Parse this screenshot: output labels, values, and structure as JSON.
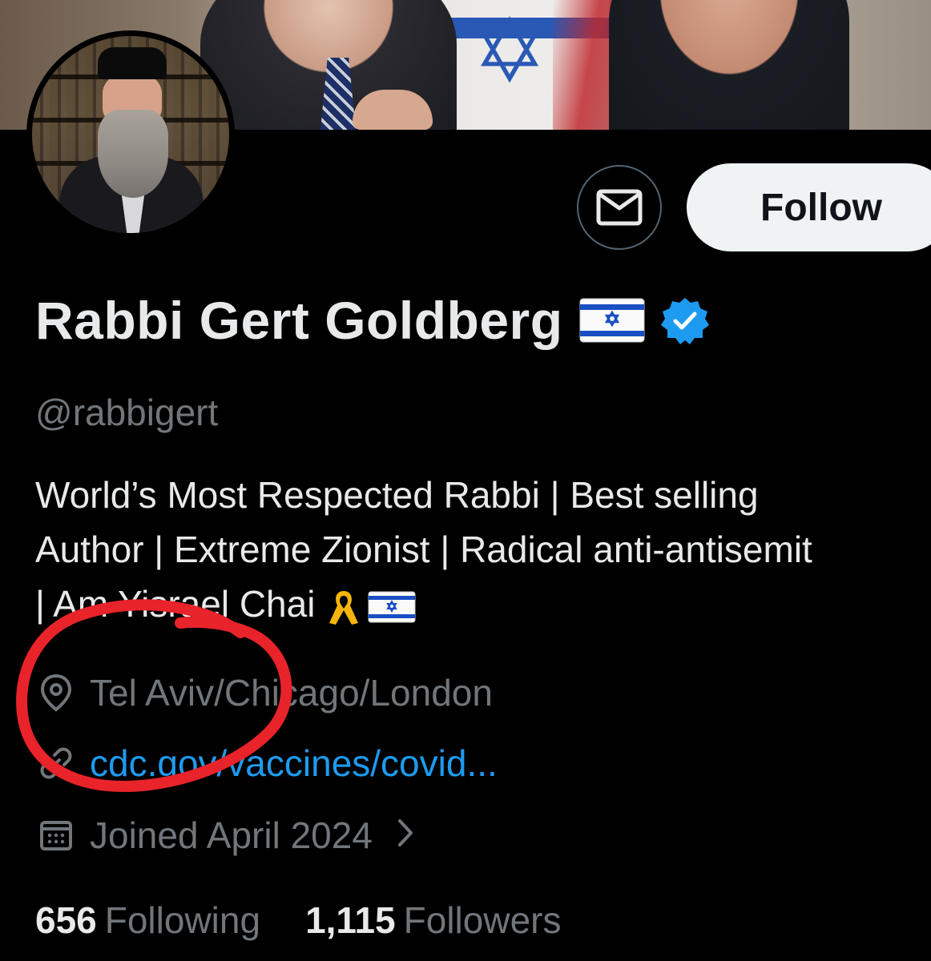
{
  "profile": {
    "display_name": "Rabbi Gert Goldberg",
    "handle": "@rabbigert",
    "bio_lines": [
      "World’s Most Respected Rabbi | Best selling",
      "Author | Extreme Zionist | Radical anti-antisemit",
      "| Am Yisrael Chai"
    ],
    "location": "Tel Aviv/Chicago/London",
    "website": "cdc.gov/vaccines/covid...",
    "joined": "Joined April 2024"
  },
  "actions": {
    "follow_label": "Follow"
  },
  "stats": {
    "following_count": "656",
    "following_label": "Following",
    "followers_count": "1,115",
    "followers_label": "Followers"
  },
  "icons": {
    "message": "envelope-icon",
    "verified": "verified-badge-icon",
    "location": "map-pin-icon",
    "link": "link-icon",
    "calendar": "calendar-icon",
    "chevron": "chevron-right-icon",
    "flag": "israel-flag-emoji",
    "ribbon": "yellow-ribbon-emoji"
  },
  "colors": {
    "background": "#000000",
    "primary_text": "#e7e9ea",
    "secondary_text": "#71767b",
    "link": "#1d9bf0",
    "verified": "#1d9bf0",
    "follow_bg": "#eff3f4",
    "annotation": "#e8232a"
  }
}
